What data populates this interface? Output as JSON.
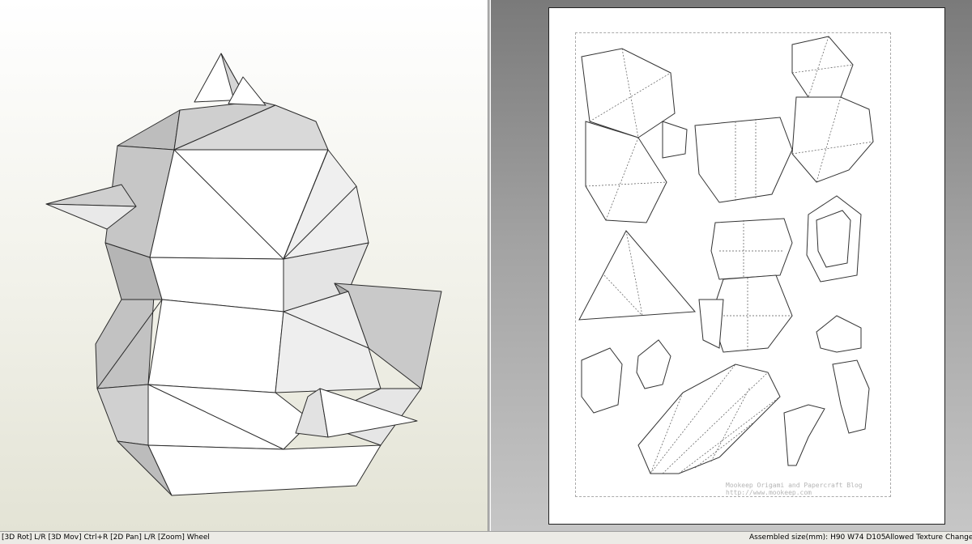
{
  "status_bar": {
    "hint": "[3D Rot] L/R [3D Mov] Ctrl+R [2D Pan] L/R [Zoom] Wheel",
    "assembled_size": "Assembled size(mm): H90 W74 D105",
    "texture_status": "Allowed Texture Change"
  },
  "unfold_sheet": {
    "watermark_line1": "Mookeep Origami and Papercraft Blog",
    "watermark_line2": "http://www.mookeep.com"
  },
  "colors": {
    "viewport_background": "#f1f1e9",
    "unfold_background": "#a2a2a2",
    "paper": "#ffffff",
    "model_light_face": "#ffffff",
    "model_shaded_face": "#bdbdbd"
  }
}
